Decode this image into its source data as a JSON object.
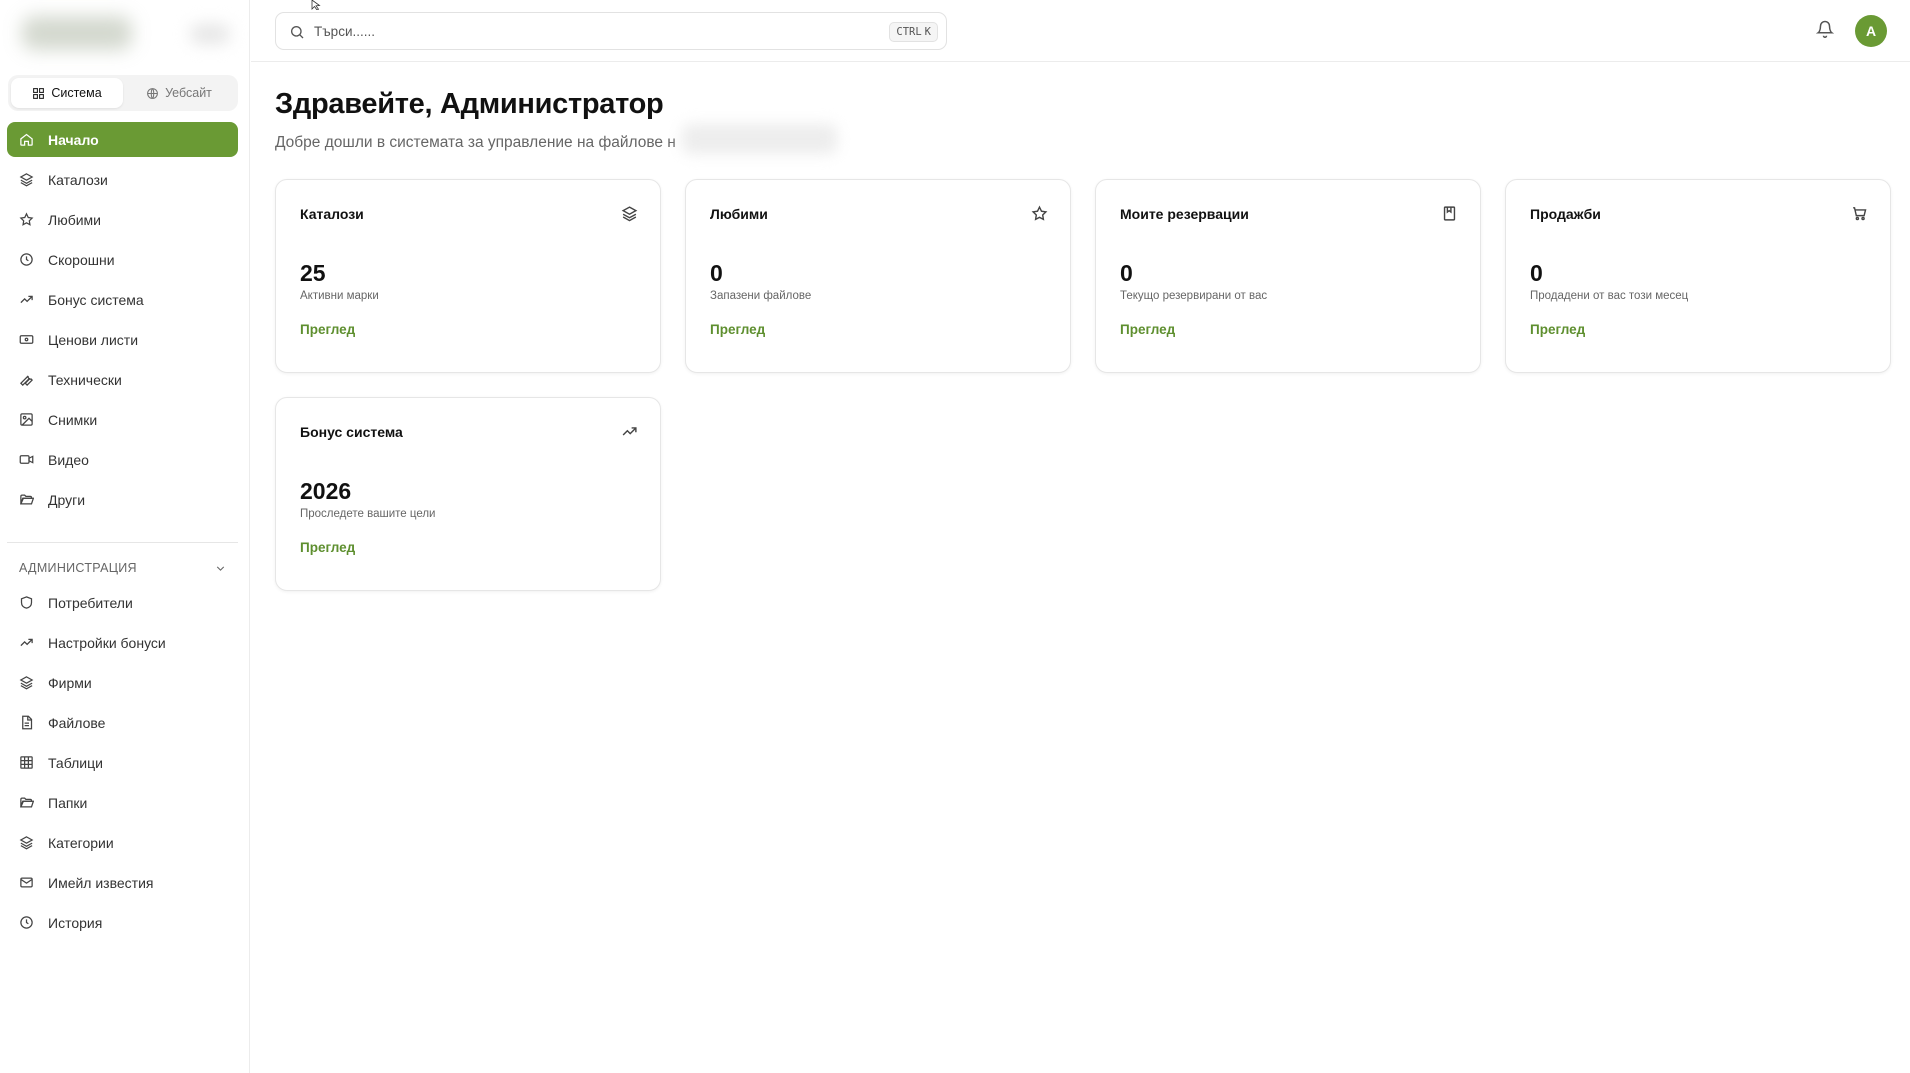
{
  "sidebar": {
    "segment": [
      {
        "label": "Система",
        "icon": "grid-icon"
      },
      {
        "label": "Уебсайт",
        "icon": "globe-icon"
      }
    ],
    "nav": [
      {
        "label": "Начало",
        "icon": "home-icon"
      },
      {
        "label": "Каталози",
        "icon": "layers-icon"
      },
      {
        "label": "Любими",
        "icon": "star-icon"
      },
      {
        "label": "Скорошни",
        "icon": "clock-icon"
      },
      {
        "label": "Бонус система",
        "icon": "trending-up-icon"
      },
      {
        "label": "Ценови листи",
        "icon": "banknote-icon"
      },
      {
        "label": "Технически",
        "icon": "wrench-icon"
      },
      {
        "label": "Снимки",
        "icon": "image-icon"
      },
      {
        "label": "Видео",
        "icon": "video-icon"
      },
      {
        "label": "Други",
        "icon": "folder-open-icon"
      }
    ],
    "admin": {
      "heading": "АДМИНИСТРАЦИЯ",
      "items": [
        {
          "label": "Потребители",
          "icon": "shield-icon"
        },
        {
          "label": "Настройки бонуси",
          "icon": "trending-up-icon"
        },
        {
          "label": "Фирми",
          "icon": "layers-icon"
        },
        {
          "label": "Файлове",
          "icon": "file-icon"
        },
        {
          "label": "Таблици",
          "icon": "table-icon"
        },
        {
          "label": "Папки",
          "icon": "folder-open-icon"
        },
        {
          "label": "Категории",
          "icon": "layers-icon"
        },
        {
          "label": "Имейл известия",
          "icon": "mail-icon"
        },
        {
          "label": "История",
          "icon": "clock-icon"
        }
      ]
    }
  },
  "topbar": {
    "search_placeholder": "Търси......",
    "shortcut_ctrl": "CTRL",
    "shortcut_key": "K",
    "avatar_letter": "A"
  },
  "main": {
    "greeting": "Здравейте, Администратор",
    "subtitle": "Добре дошли в системата за управление на файлове н",
    "cards": [
      {
        "title": "Каталози",
        "icon": "layers-icon",
        "value": "25",
        "desc": "Активни марки",
        "link": "Преглед"
      },
      {
        "title": "Любими",
        "icon": "star-icon",
        "value": "0",
        "desc": "Запазени файлове",
        "link": "Преглед"
      },
      {
        "title": "Моите резервации",
        "icon": "bookmark-icon",
        "value": "0",
        "desc": "Текущо резервирани от вас",
        "link": "Преглед"
      },
      {
        "title": "Продажби",
        "icon": "cart-icon",
        "value": "0",
        "desc": "Продадени от вас този месец",
        "link": "Преглед"
      },
      {
        "title": "Бонус система",
        "icon": "trending-up-icon",
        "value": "2026",
        "desc": "Проследете вашите цели",
        "link": "Преглед"
      }
    ]
  },
  "colors": {
    "accent": "#6a9a34",
    "link": "#5e8f2f"
  }
}
